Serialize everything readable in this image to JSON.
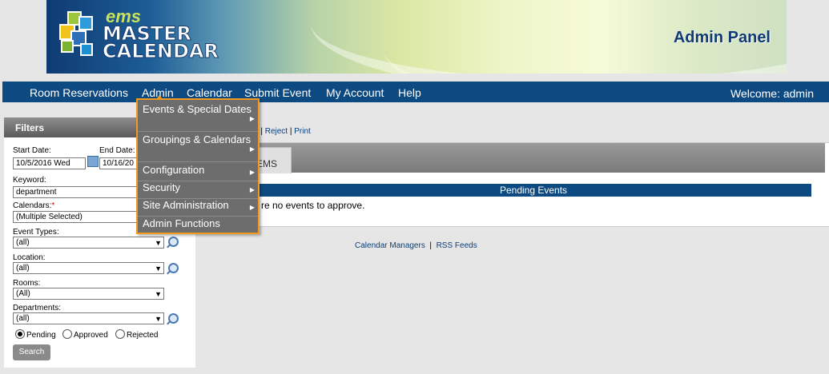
{
  "banner": {
    "logo_small": "ems",
    "logo_line1": "MASTER",
    "logo_line2": "CALENDAR",
    "panel_title": "Admin Panel"
  },
  "nav": {
    "items": [
      "Room Reservations",
      "Admin",
      "Calendar",
      "Submit Event",
      "My Account",
      "Help"
    ],
    "welcome": "Welcome: admin"
  },
  "admin_menu": {
    "items": [
      {
        "label": "Events & Special Dates",
        "has_submenu": true
      },
      {
        "label": "Groupings & Calendars",
        "has_submenu": true
      },
      {
        "label": "Configuration",
        "has_submenu": true
      },
      {
        "label": "Security",
        "has_submenu": true
      },
      {
        "label": "Site Administration",
        "has_submenu": true
      },
      {
        "label": "Admin Functions",
        "has_submenu": false
      }
    ]
  },
  "filters": {
    "title": "Filters",
    "start_date_label": "Start Date:",
    "start_date_value": "10/5/2016 Wed",
    "end_date_label": "End Date:",
    "end_date_value": "10/16/20",
    "keyword_label": "Keyword:",
    "keyword_value": "department",
    "calendars_label": "Calendars:",
    "calendars_required": "*",
    "calendars_value": "(Multiple Selected)",
    "event_types_label": "Event Types:",
    "event_types_value": "(all)",
    "location_label": "Location:",
    "location_value": "(all)",
    "rooms_label": "Rooms:",
    "rooms_value": "(All)",
    "departments_label": "Departments:",
    "departments_value": "(all)",
    "status_options": [
      {
        "label": "Pending",
        "selected": true
      },
      {
        "label": "Approved",
        "selected": false
      },
      {
        "label": "Rejected",
        "selected": false
      }
    ],
    "search_label": "Search"
  },
  "main": {
    "actions_partial": "ve",
    "action_reject": "Reject",
    "action_print": "Print",
    "tab_label_partial": "EMS",
    "pending_header": "Pending Events",
    "no_events_partial": "re no events to approve."
  },
  "footer": {
    "link1": "Calendar Managers",
    "separator": "|",
    "link2": "RSS Feeds"
  },
  "colors": {
    "nav_bg": "#0d4a82",
    "menu_bg": "#6d6d6d",
    "menu_border": "#f39a1e",
    "link": "#0b3e7a"
  }
}
